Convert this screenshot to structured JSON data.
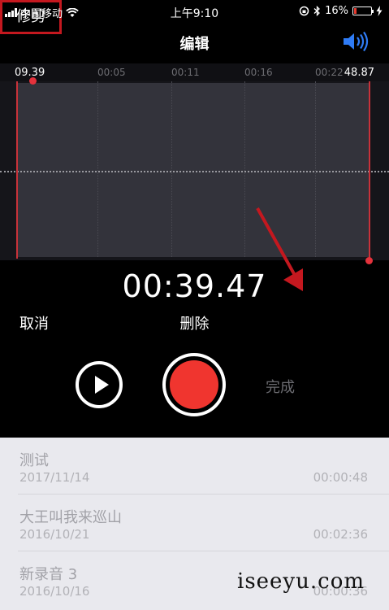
{
  "status_bar": {
    "carrier": "中国移动",
    "time": "上午9:10",
    "battery": "16%",
    "battery_level": 0.16,
    "icons": [
      "signal-icon",
      "wifi-icon",
      "rotation-lock-icon",
      "bluetooth-icon",
      "battery-icon",
      "charging-icon"
    ]
  },
  "nav": {
    "title": "编辑",
    "speaker_icon": "speaker-icon"
  },
  "timeline": {
    "ticks": [
      "00:05",
      "00:11",
      "00:16",
      "00:22"
    ],
    "selection_start": "09.39",
    "selection_end": "48.87"
  },
  "time_display": "00:39.47",
  "actions": {
    "cancel": "取消",
    "delete": "删除",
    "trim": "修剪"
  },
  "controls": {
    "play_icon": "play-icon",
    "record_icon": "record-icon",
    "done": "完成"
  },
  "recordings": [
    {
      "name": "测试",
      "date": "2017/11/14",
      "duration": "00:00:48"
    },
    {
      "name": "大王叫我来巡山",
      "date": "2016/10/21",
      "duration": "00:02:36"
    },
    {
      "name": "新录音 3",
      "date": "2016/10/16",
      "duration": "00:00:36"
    }
  ],
  "watermark": "iseeyu.com",
  "colors": {
    "accent_red": "#f0352f",
    "annotation_red": "#c4181f",
    "ios_blue": "#2f7cf6"
  }
}
